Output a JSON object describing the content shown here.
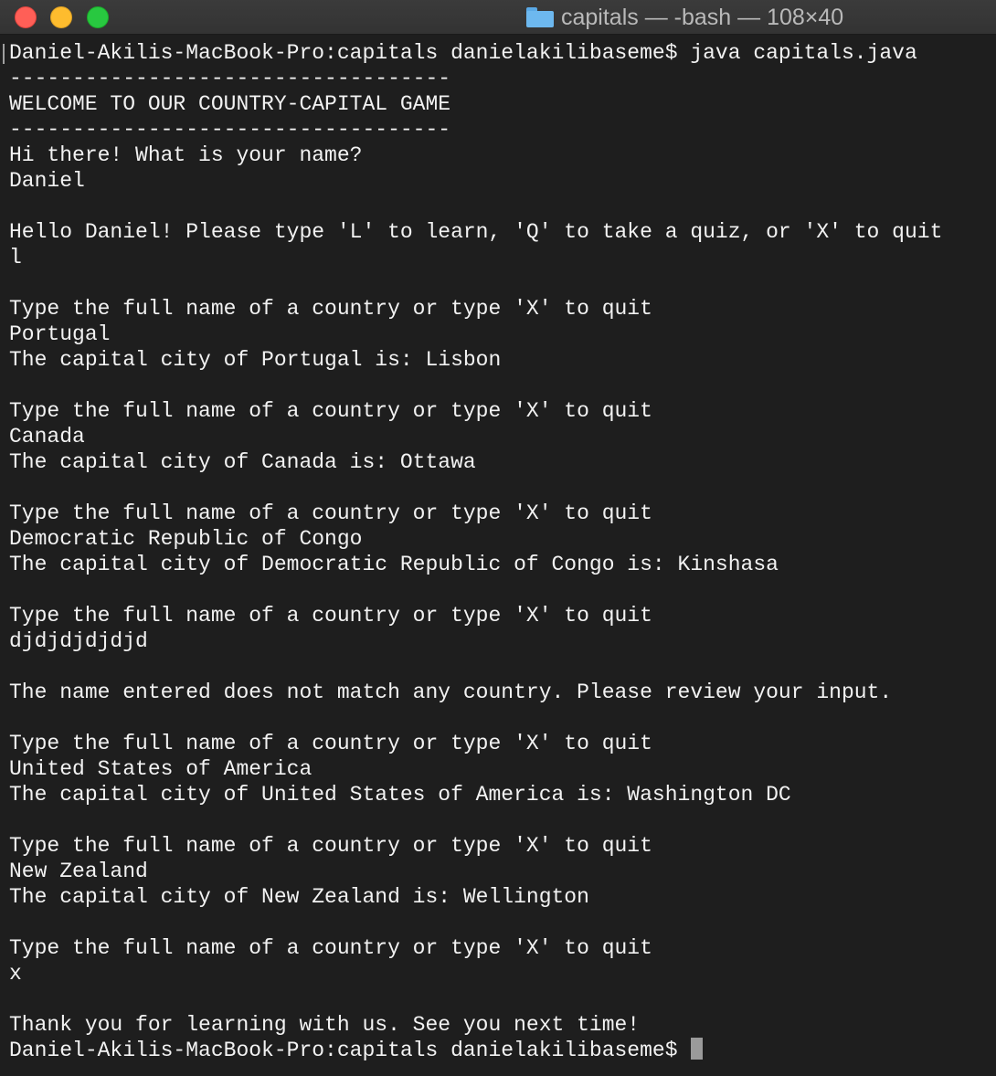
{
  "window": {
    "title": "capitals — -bash — 108×40"
  },
  "terminal": {
    "prompt": "Daniel-Akilis-MacBook-Pro:capitals danielakilibaseme$",
    "lines": [
      "Daniel-Akilis-MacBook-Pro:capitals danielakilibaseme$ java capitals.java",
      "-----------------------------------",
      "WELCOME TO OUR COUNTRY-CAPITAL GAME",
      "-----------------------------------",
      "Hi there! What is your name?",
      "Daniel",
      "",
      "Hello Daniel! Please type 'L' to learn, 'Q' to take a quiz, or 'X' to quit",
      "l",
      "",
      "Type the full name of a country or type 'X' to quit",
      "Portugal",
      "The capital city of Portugal is: Lisbon",
      "",
      "Type the full name of a country or type 'X' to quit",
      "Canada",
      "The capital city of Canada is: Ottawa",
      "",
      "Type the full name of a country or type 'X' to quit",
      "Democratic Republic of Congo",
      "The capital city of Democratic Republic of Congo is: Kinshasa",
      "",
      "Type the full name of a country or type 'X' to quit",
      "djdjdjdjdjd",
      "",
      "The name entered does not match any country. Please review your input.",
      "",
      "Type the full name of a country or type 'X' to quit",
      "United States of America",
      "The capital city of United States of America is: Washington DC",
      "",
      "Type the full name of a country or type 'X' to quit",
      "New Zealand",
      "The capital city of New Zealand is: Wellington",
      "",
      "Type the full name of a country or type 'X' to quit",
      "x",
      "",
      "Thank you for learning with us. See you next time!"
    ]
  },
  "colors": {
    "background": "#1e1e1e",
    "text": "#f2f2f2",
    "cursor": "#9a9a9a"
  }
}
